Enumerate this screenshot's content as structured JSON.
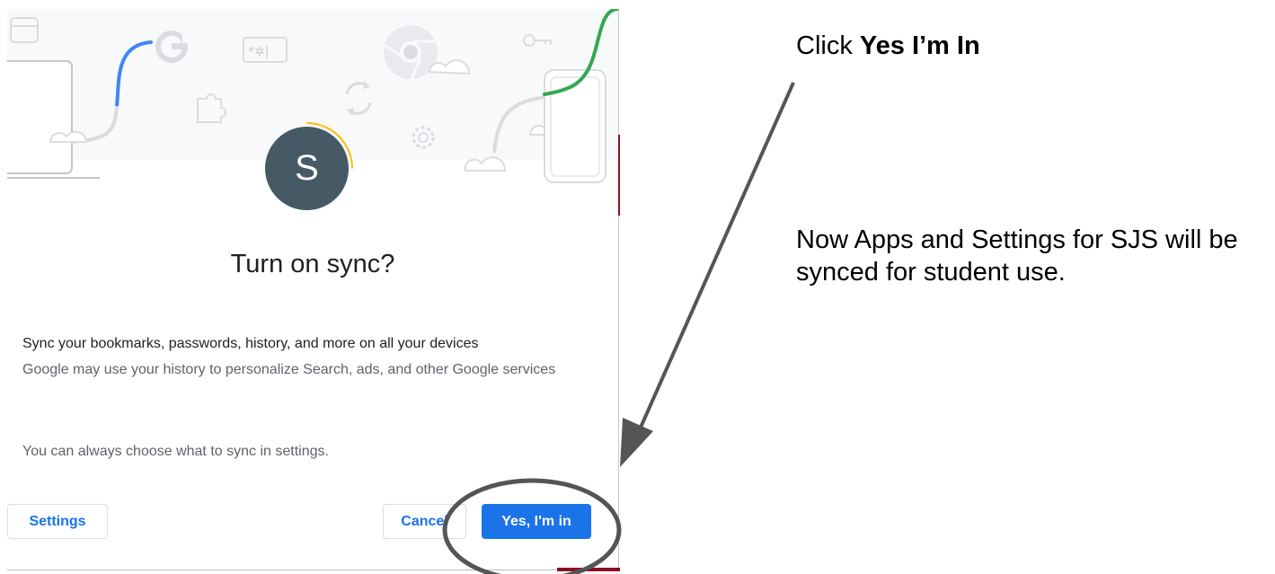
{
  "dialog": {
    "avatar_letter": "S",
    "title": "Turn on sync?",
    "sync_description": "Sync your bookmarks, passwords, history, and more on all your devices",
    "personalize_note": "Google may use your history to personalize Search, ads, and other Google services",
    "settings_note": "You can always choose what to sync in settings.",
    "buttons": {
      "settings": "Settings",
      "cancel": "Cancel",
      "yes": "Yes, I'm in"
    },
    "colors": {
      "primary": "#1a73e8",
      "avatar": "#455a64",
      "illustration_blue": "#4285f4",
      "illustration_green": "#34a853",
      "illustration_yellow": "#fbbc04"
    },
    "illustration_icons": [
      "card-icon",
      "google-g-icon",
      "password-icon",
      "chrome-icon",
      "key-icon",
      "puzzle-icon",
      "sync-icon",
      "gear-icon",
      "cloud-icon",
      "laptop-icon",
      "phone-icon"
    ]
  },
  "annotations": {
    "click_prefix": "Click ",
    "click_target": "Yes I’m In",
    "note": "Now Apps and Settings for SJS will be synced for student use.",
    "arrow_color": "#555555",
    "highlight_ellipse_color": "#555555"
  }
}
